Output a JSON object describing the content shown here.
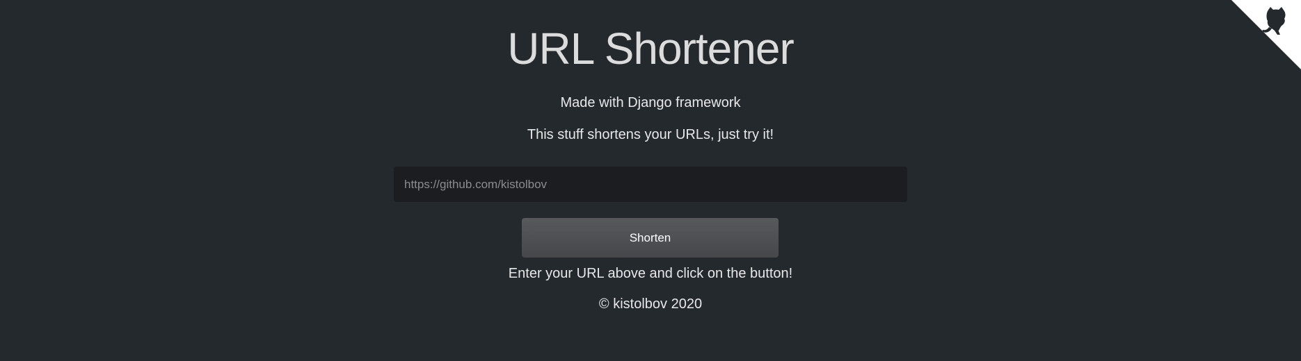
{
  "page": {
    "title": "URL Shortener",
    "subtitle": "Made with Django framework",
    "description": "This stuff shortens your URLs, just try it!"
  },
  "form": {
    "url_placeholder": "https://github.com/kistolbov",
    "shorten_label": "Shorten"
  },
  "hint": "Enter your URL above and click on the button!",
  "footer": {
    "copyright": "© kistolbov 2020"
  },
  "corner": {
    "icon": "github-octocat-icon",
    "fill_color": "#ffffff",
    "icon_color": "#24292e"
  },
  "colors": {
    "background": "#24292e",
    "input_background": "#1c1d21",
    "button_background": "#4e5053"
  }
}
